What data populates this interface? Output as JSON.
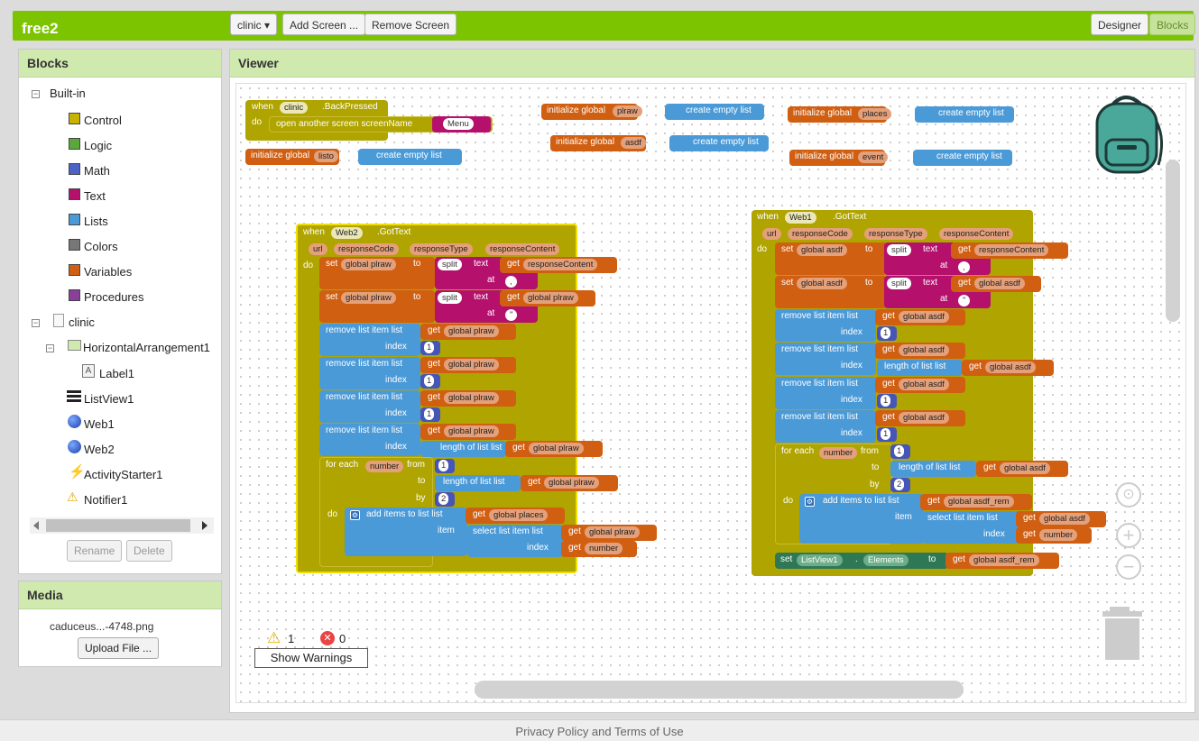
{
  "app": {
    "title": "free2"
  },
  "toolbar": {
    "screen_select": "clinic ▾",
    "add_screen": "Add Screen ...",
    "remove_screen": "Remove Screen",
    "designer": "Designer",
    "blocks": "Blocks"
  },
  "blocks_panel": {
    "title": "Blocks",
    "builtin_label": "Built-in",
    "builtin": [
      {
        "label": "Control",
        "color": "#c8b400"
      },
      {
        "label": "Logic",
        "color": "#5aa83a"
      },
      {
        "label": "Math",
        "color": "#4b63c4"
      },
      {
        "label": "Text",
        "color": "#b4106c"
      },
      {
        "label": "Lists",
        "color": "#4b9ad8"
      },
      {
        "label": "Colors",
        "color": "#777777"
      },
      {
        "label": "Variables",
        "color": "#d05f12"
      },
      {
        "label": "Procedures",
        "color": "#8a3f9a"
      }
    ],
    "screen_label": "clinic",
    "components": {
      "arrangement": "HorizontalArrangement1",
      "label1": "Label1",
      "listview": "ListView1",
      "web1": "Web1",
      "web2": "Web2",
      "activity": "ActivityStarter1",
      "notifier": "Notifier1"
    },
    "rename": "Rename",
    "delete": "Delete"
  },
  "media_panel": {
    "title": "Media",
    "file": "caduceus...-4748.png",
    "upload": "Upload File ..."
  },
  "viewer": {
    "title": "Viewer",
    "warnings_count": "1",
    "errors_count": "0",
    "show_warnings": "Show Warnings"
  },
  "blocks": {
    "when": "when",
    "do": "do",
    "to": "to",
    "at": "at",
    "index": "index",
    "list": "list",
    "item": "item",
    "text": "text",
    "get": "get",
    "by": "by",
    "from": "from",
    "set": "set",
    "initialize_global": "initialize global",
    "create_empty_list": "create empty list",
    "back_pressed_comp": "clinic",
    "back_pressed": ".BackPressed",
    "open_another_screen": "open another screen  screenName",
    "menu_text": "Menu",
    "var_plraw": "plraw",
    "var_asdf": "asdf",
    "var_listo": "listo",
    "var_places": "places",
    "var_event": "event",
    "web2": "Web2",
    "web1": "Web1",
    "got_text": ".GotText",
    "url": "url",
    "response_code": "responseCode",
    "response_type": "responseType",
    "response_content": "responseContent",
    "global_plraw": "global plraw",
    "global_asdf": "global asdf",
    "global_places": "global places",
    "global_asdf_rem": "global asdf_rem",
    "split": "split",
    "sep_comma": ",",
    "sep_quote": "\"",
    "remove_list_item": "remove list item",
    "length_of_list": "length of list",
    "for_each": "for each",
    "number": "number",
    "add_items_to_list": "add items to list",
    "select_list_item": "select list item",
    "one": "1",
    "two": "2",
    "listview1": "ListView1",
    "elements": "Elements"
  },
  "footer": {
    "text": "Privacy Policy and Terms of Use"
  }
}
